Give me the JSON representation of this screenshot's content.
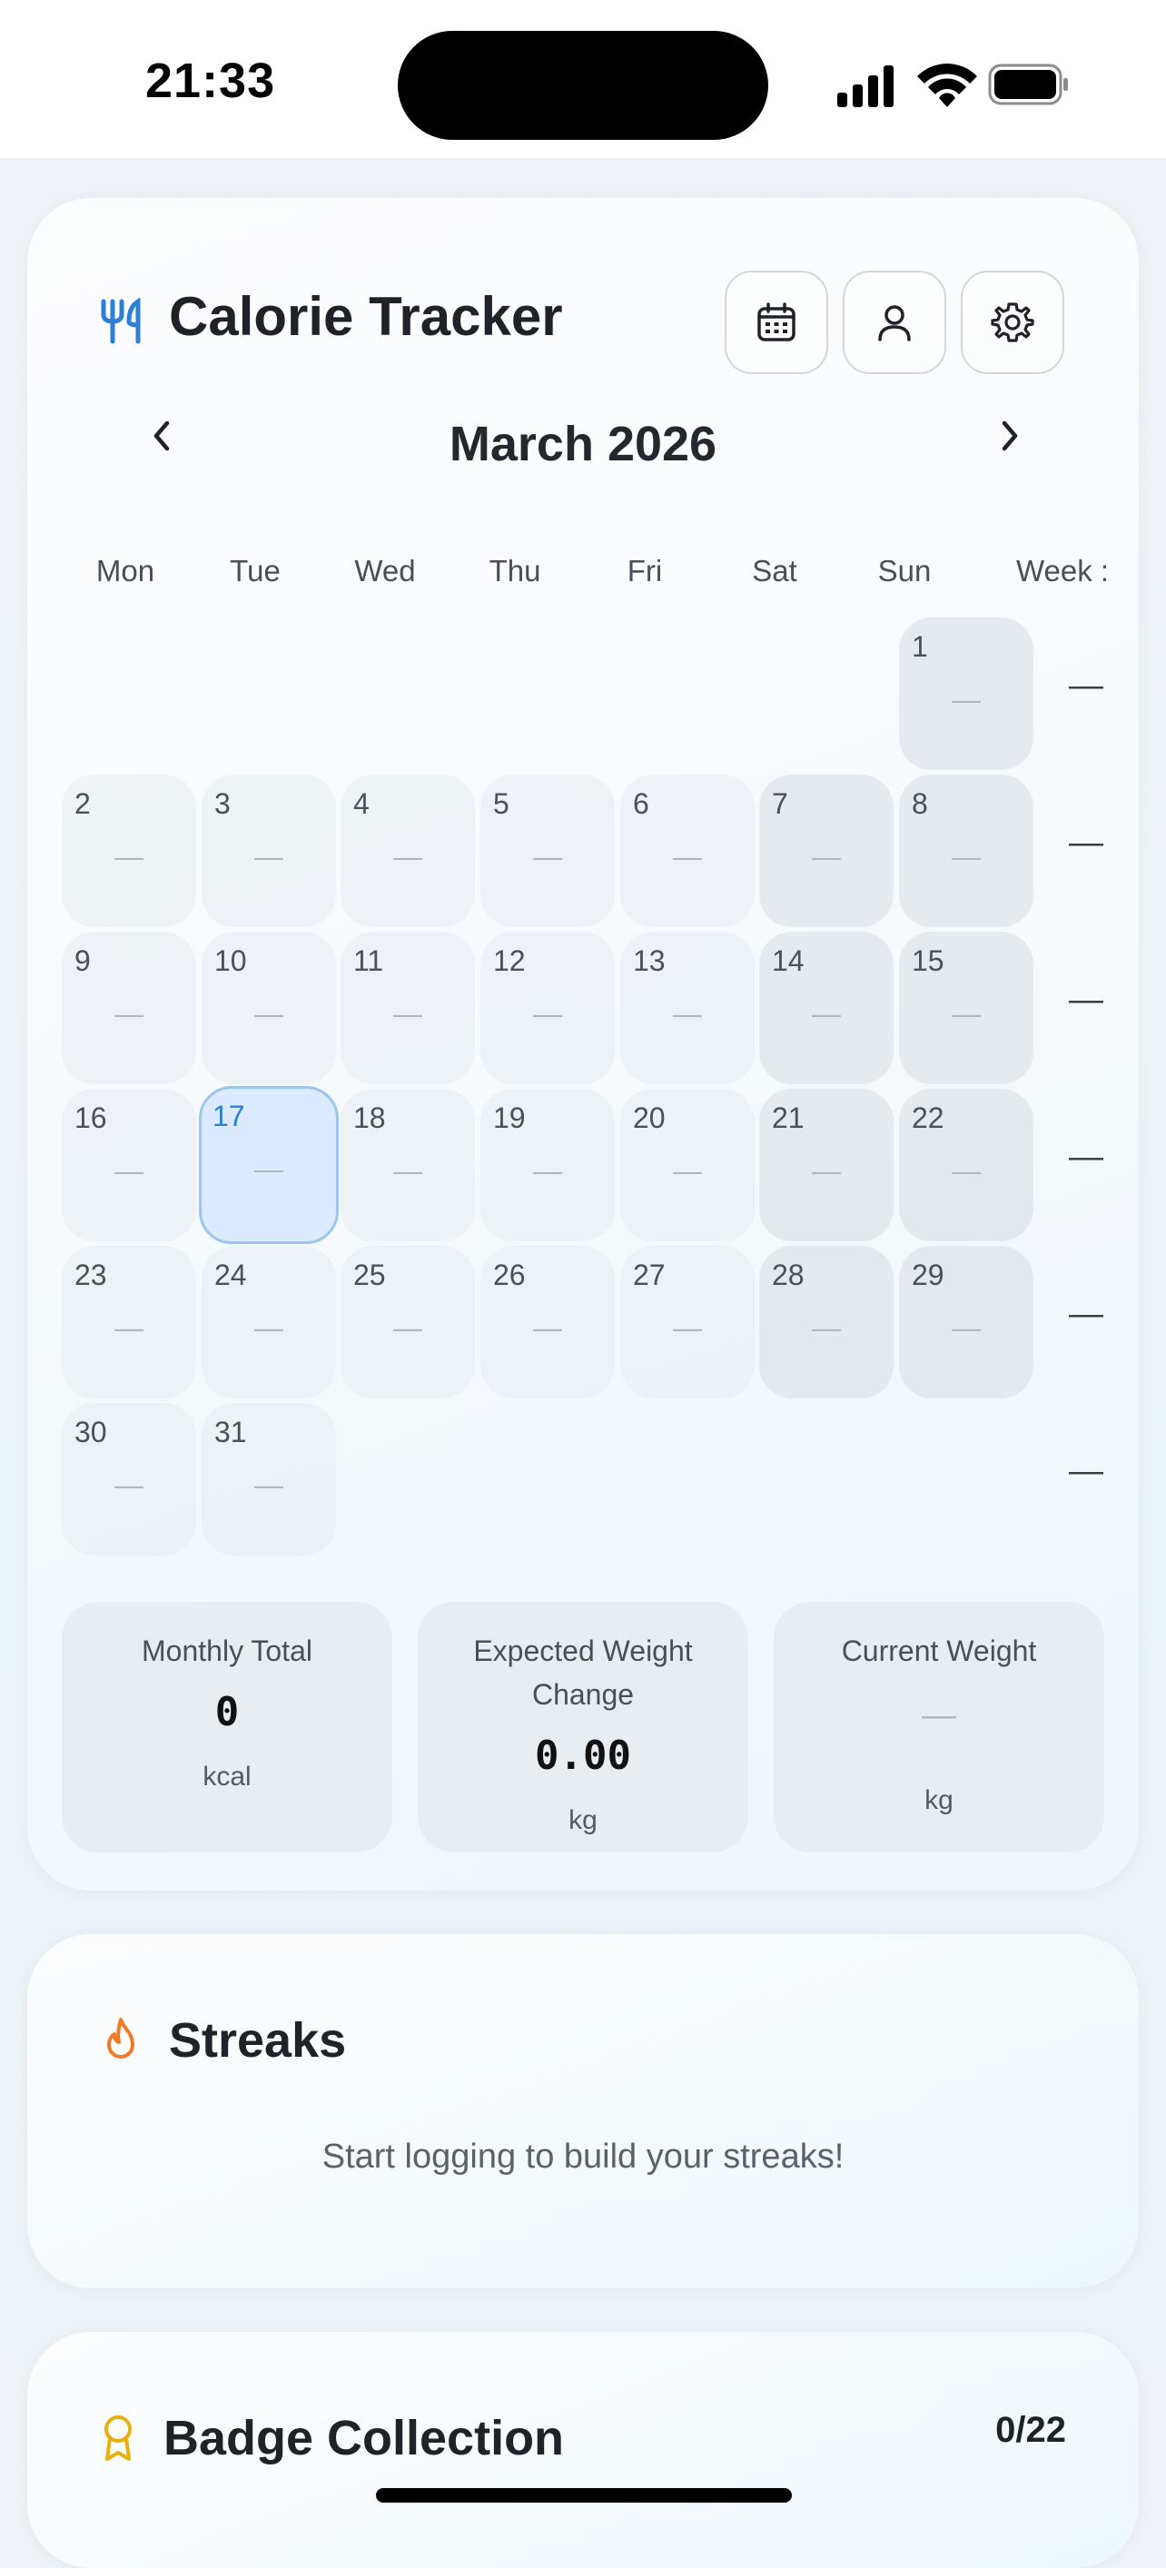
{
  "status_bar": {
    "time": "21:33"
  },
  "header": {
    "title": "Calorie Tracker"
  },
  "calendar": {
    "month_label": "March 2026",
    "weekday_headers": [
      "Mon",
      "Tue",
      "Wed",
      "Thu",
      "Fri",
      "Sat",
      "Sun",
      "Week :"
    ],
    "empty_value": "—",
    "week_total_placeholder": "—",
    "selected_day": "17",
    "days": [
      "1",
      "2",
      "3",
      "4",
      "5",
      "6",
      "7",
      "8",
      "9",
      "10",
      "11",
      "12",
      "13",
      "14",
      "15",
      "16",
      "17",
      "18",
      "19",
      "20",
      "21",
      "22",
      "23",
      "24",
      "25",
      "26",
      "27",
      "28",
      "29",
      "30",
      "31"
    ]
  },
  "stats": {
    "monthly_total": {
      "label": "Monthly Total",
      "value": "0",
      "unit": "kcal"
    },
    "expected_weight_change": {
      "label": "Expected Weight Change",
      "value": "0.00",
      "unit": "kg"
    },
    "current_weight": {
      "label": "Current Weight",
      "value": "—",
      "unit": "kg"
    }
  },
  "streaks": {
    "title": "Streaks",
    "message": "Start logging to build your streaks!"
  },
  "badges": {
    "title": "Badge Collection",
    "count": "0/22"
  },
  "colors": {
    "accent": "#2b7fd6",
    "streak_icon": "#f07a2a",
    "badge_icon": "#e7b10a",
    "selected_bg": "#dbeafe"
  }
}
